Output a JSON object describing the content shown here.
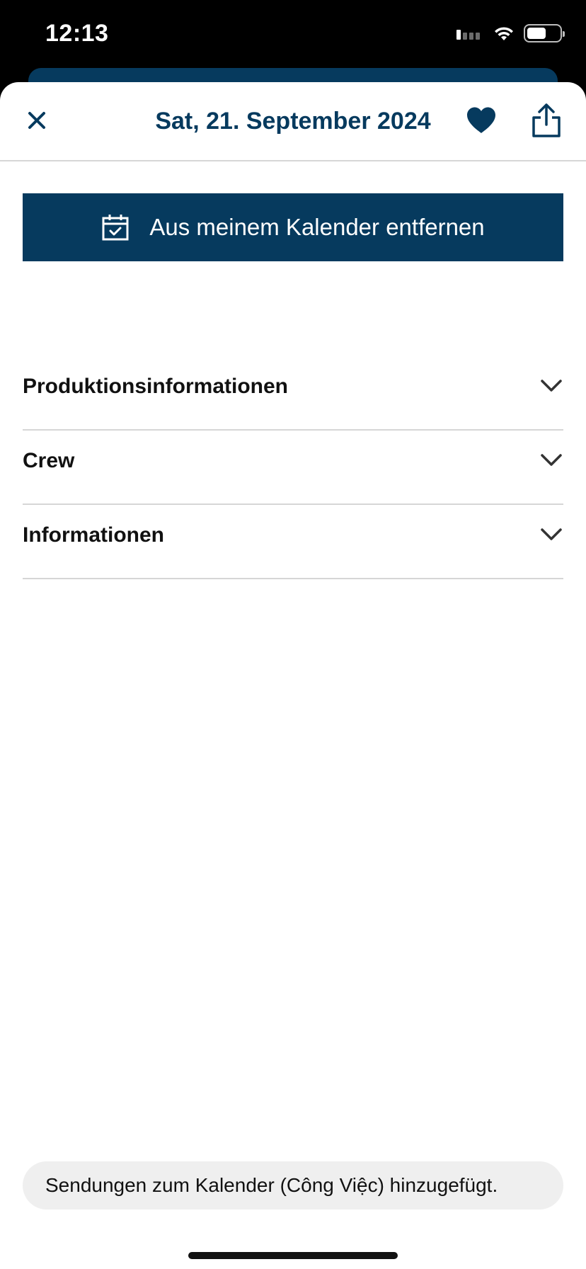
{
  "status_bar": {
    "time": "12:13"
  },
  "header": {
    "title": "Sat, 21. September 2024",
    "close_icon": "close-icon",
    "favorite_icon": "heart-icon",
    "share_icon": "share-icon"
  },
  "calendar_button": {
    "label": "Aus meinem Kalender entfernen",
    "icon": "calendar-check-icon"
  },
  "sections": [
    {
      "label": "Produktionsinformationen",
      "icon": "chevron-down-icon"
    },
    {
      "label": "Crew",
      "icon": "chevron-down-icon"
    },
    {
      "label": "Informationen",
      "icon": "chevron-down-icon"
    }
  ],
  "toast": {
    "message": "Sendungen zum Kalender (Công Việc) hinzugefügt."
  },
  "colors": {
    "brand": "#063a5e",
    "toast_bg": "#efefef",
    "divider": "#d6d6d6"
  }
}
